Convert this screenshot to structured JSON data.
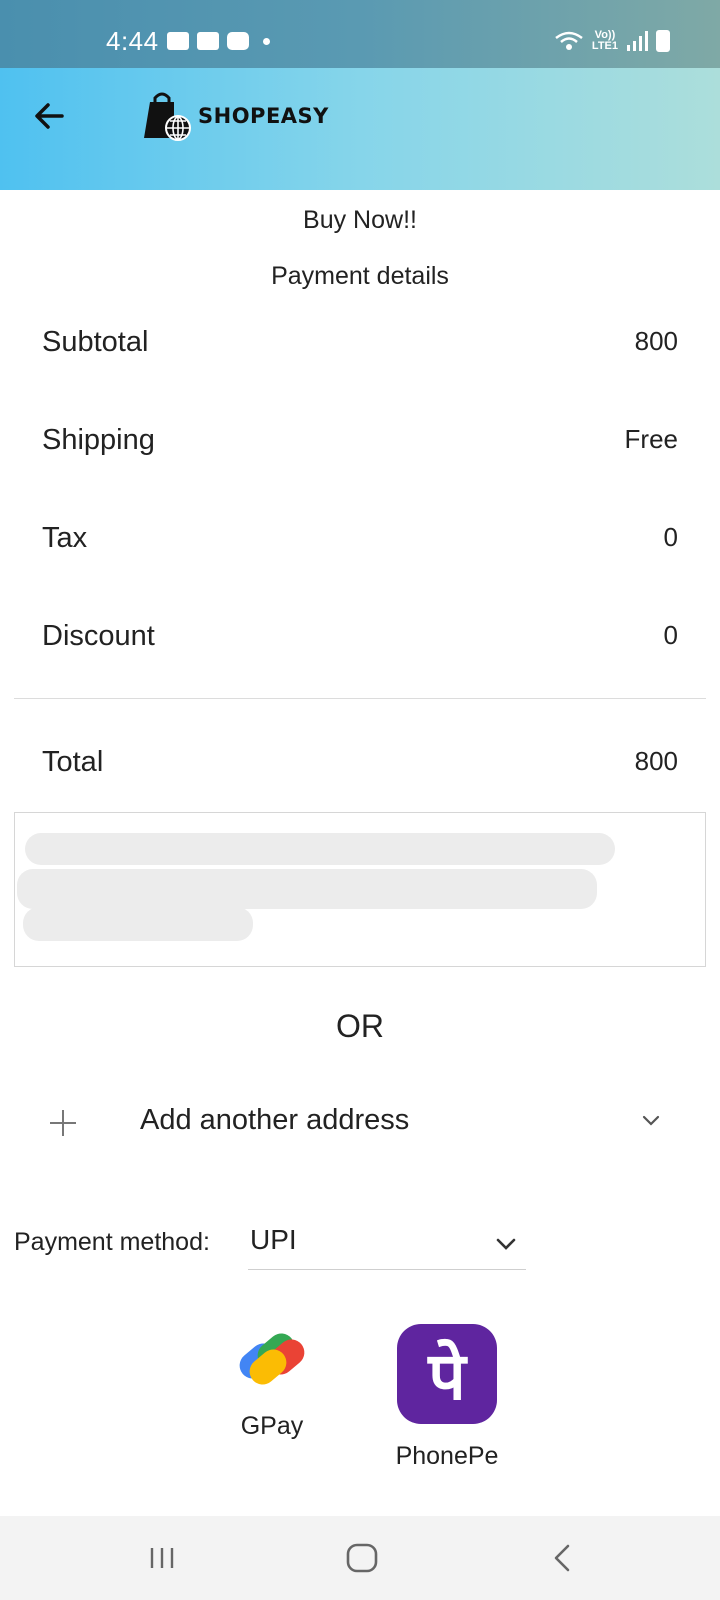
{
  "status_bar": {
    "time": "4:44",
    "network_label_top": "Vo))",
    "network_label_bottom": "LTE1"
  },
  "header": {
    "brand": "SHOPEASY",
    "back_icon": "arrow-left-icon",
    "logo_icon": "shopping-bag-globe-icon",
    "gradient_colors": [
      "#4fc1f0",
      "#acdedb"
    ]
  },
  "page": {
    "title": "Buy Now!!",
    "subtitle": "Payment details"
  },
  "summary": {
    "subtotal_label": "Subtotal",
    "subtotal_value": "800",
    "shipping_label": "Shipping",
    "shipping_value": "Free",
    "tax_label": "Tax",
    "tax_value": "0",
    "discount_label": "Discount",
    "discount_value": "0",
    "total_label": "Total",
    "total_value": "800"
  },
  "address": {
    "redacted": true
  },
  "or_text": "OR",
  "add_address": {
    "label": "Add another address"
  },
  "payment": {
    "label": "Payment method:",
    "selected": "UPI",
    "apps": [
      {
        "name": "GPay"
      },
      {
        "name": "PhonePe"
      }
    ],
    "phonepe_color": "#5f259f"
  }
}
